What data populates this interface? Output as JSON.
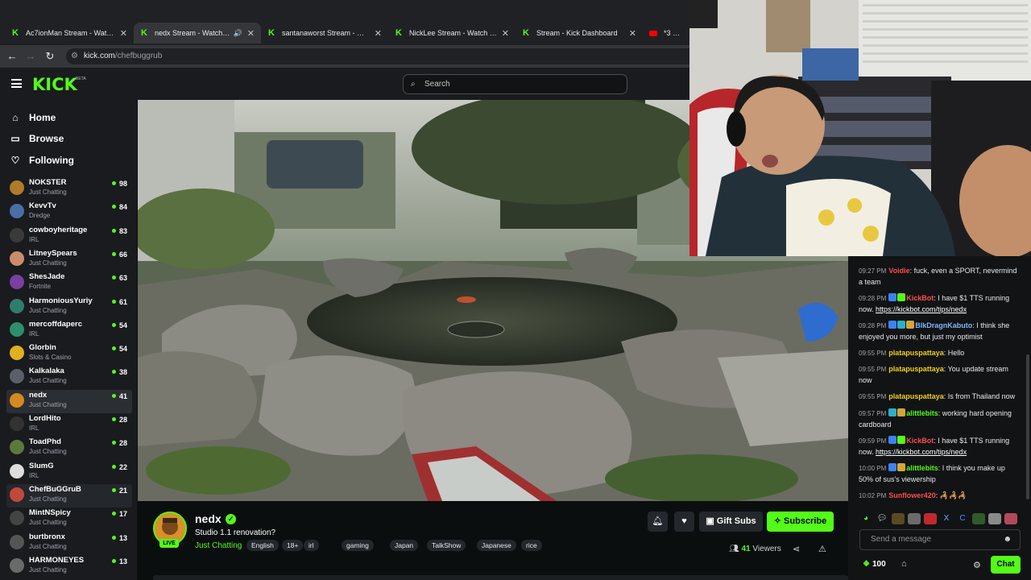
{
  "browser": {
    "tabs": [
      {
        "title": "Ac7ionMan Stream - Watch Live",
        "icon": "kick-icon"
      },
      {
        "title": "nedx Stream - Watch Live on",
        "icon": "kick-icon",
        "active": true
      },
      {
        "title": "santanaworst Stream - Watch Li",
        "icon": "kick-icon"
      },
      {
        "title": "NickLee Stream - Watch Live on",
        "icon": "kick-icon"
      },
      {
        "title": "Stream - Kick Dashboard",
        "icon": "kick-icon"
      },
      {
        "title": "*3 BODY",
        "icon": "youtube-icon"
      }
    ],
    "url_host": "kick.com",
    "url_path": "/chefbuggrub"
  },
  "header": {
    "logo": "KICK",
    "beta": "BETA",
    "search_placeholder": "Search"
  },
  "sidebar": {
    "nav": [
      {
        "label": "Home",
        "icon": "home-icon"
      },
      {
        "label": "Browse",
        "icon": "browse-icon"
      },
      {
        "label": "Following",
        "icon": "heart-icon"
      }
    ],
    "channels": [
      {
        "name": "NOKSTER",
        "category": "Just Chatting",
        "viewers": "98",
        "color": "#b07a2a"
      },
      {
        "name": "KevvTv",
        "category": "Dredge",
        "viewers": "84",
        "color": "#4a6fa5"
      },
      {
        "name": "cowboyheritage",
        "category": "IRL",
        "viewers": "83",
        "color": "#3a3a3a"
      },
      {
        "name": "LitneySpears",
        "category": "Just Chatting",
        "viewers": "66",
        "color": "#c98d6b"
      },
      {
        "name": "ShesJade",
        "category": "Fortnite",
        "viewers": "63",
        "color": "#7a3fa0"
      },
      {
        "name": "HarmoniousYuriy",
        "category": "Just Chatting",
        "viewers": "61",
        "color": "#2f7d6a"
      },
      {
        "name": "mercoffdaperc",
        "category": "IRL",
        "viewers": "54",
        "color": "#2c8f6d"
      },
      {
        "name": "Glorbin",
        "category": "Slots & Casino",
        "viewers": "54",
        "color": "#e0b020"
      },
      {
        "name": "Kalkalaka",
        "category": "Just Chatting",
        "viewers": "38",
        "color": "#5a5f6a"
      },
      {
        "name": "nedx",
        "category": "Just Chatting",
        "viewers": "41",
        "color": "#d48a1e"
      },
      {
        "name": "LordHito",
        "category": "IRL",
        "viewers": "28",
        "color": "#333"
      },
      {
        "name": "ToadPhd",
        "category": "Just Chatting",
        "viewers": "28",
        "color": "#5b7a3a"
      },
      {
        "name": "SlumG",
        "category": "IRL",
        "viewers": "22",
        "color": "#ddd"
      },
      {
        "name": "ChefBuGGruB",
        "category": "Just Chatting",
        "viewers": "21",
        "color": "#c04a3a"
      },
      {
        "name": "MintNSpicy",
        "category": "Just Chatting",
        "viewers": "17",
        "color": "#444"
      },
      {
        "name": "burtbronx",
        "category": "Just Chatting",
        "viewers": "13",
        "color": "#555"
      },
      {
        "name": "HARMONEYES",
        "category": "Just Chatting",
        "viewers": "13",
        "color": "#6a6a6a"
      }
    ]
  },
  "stream": {
    "name": "nedx",
    "live_label": "LIVE",
    "title": "Studio 1.1 renovation?",
    "category": "Just Chatting",
    "tags": [
      "English",
      "18+",
      "irl",
      "gaming",
      "Japan",
      "TalkShow",
      "Japanese",
      "rice"
    ],
    "gift_label": "Gift Subs",
    "subscribe_label": "Subscribe",
    "viewers_count": "41",
    "viewers_label": "Viewers"
  },
  "chat": {
    "messages": [
      {
        "time": "09:27 PM",
        "user": "Voidie",
        "user_color": "#ff4d4d",
        "text": "fuck, even a SPORT, nevermind a team",
        "badges": []
      },
      {
        "time": "09:28 PM",
        "user": "KickBot",
        "user_color": "#ff4d4d",
        "text": "I have $1 TTS running now. ",
        "link": "https://kickbot.com/tips/nedx",
        "badges": [
          "#3b82f6",
          "#53fc18"
        ]
      },
      {
        "time": "09:28 PM",
        "user": "BlkDragnKabuto",
        "user_color": "#7fb8ff",
        "text": "I think she enjoyed you more, but just my optimist",
        "badges": [
          "#3b82f6",
          "#2bb0c9",
          "#d4a73a"
        ]
      },
      {
        "time": "09:55 PM",
        "user": "platapuspattaya",
        "user_color": "#f0d020",
        "text": "Hello",
        "badges": []
      },
      {
        "time": "09:55 PM",
        "user": "platapuspattaya",
        "user_color": "#f0d020",
        "text": "You update stream now",
        "badges": []
      },
      {
        "time": "09:55 PM",
        "user": "platapuspattaya",
        "user_color": "#f0d020",
        "text": "Is from Thailand now",
        "badges": []
      },
      {
        "time": "09:57 PM",
        "user": "alittlebits",
        "user_color": "#53fc18",
        "text": "working hard opening cardboard",
        "badges": [
          "#2bb0c9",
          "#d4a73a"
        ]
      },
      {
        "time": "09:59 PM",
        "user": "KickBot",
        "user_color": "#ff4d4d",
        "text": "I have $1 TTS running now. ",
        "link": "https://kickbot.com/tips/nedx",
        "badges": [
          "#3b82f6",
          "#53fc18"
        ]
      },
      {
        "time": "10:00 PM",
        "user": "alittlebits",
        "user_color": "#53fc18",
        "text": "I think you make up 50% of sus's viewership",
        "badges": [
          "#3b82f6",
          "#d4a73a"
        ]
      },
      {
        "time": "10:02 PM",
        "user": "Sunflower420",
        "user_color": "#ff4d4d",
        "text": "",
        "badges": []
      }
    ],
    "input_placeholder": "Send a message",
    "points": "100",
    "chat_button": "Chat"
  }
}
